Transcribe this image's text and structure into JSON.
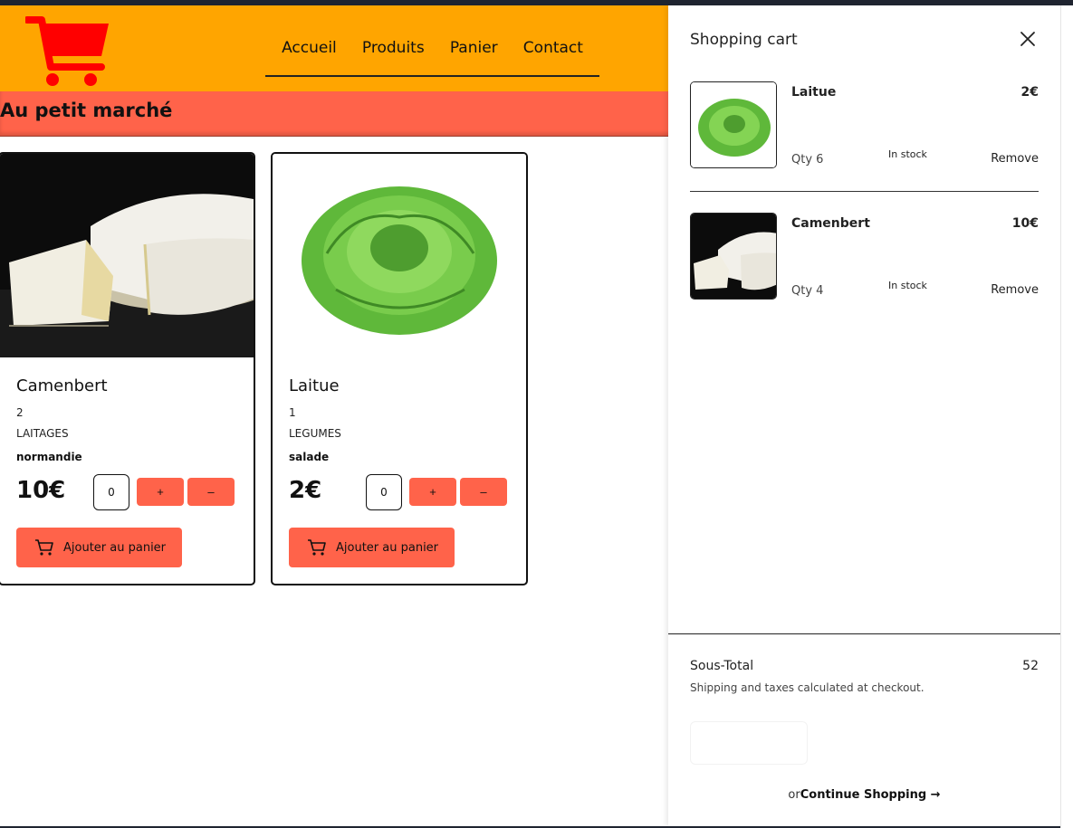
{
  "header": {
    "nav": [
      "Accueil",
      "Produits",
      "Panier",
      "Contact"
    ],
    "logo_icon": "shopping-cart-icon",
    "logo_color": "#ff0000",
    "bg_color": "#ffa500"
  },
  "page_title": "Au petit marché",
  "accent_color": "#ff634a",
  "products": [
    {
      "name": "Camenbert",
      "qty": "2",
      "category": "LAITAGES",
      "origin": "normandie",
      "price": "10€",
      "input_value": "0",
      "plus": "+",
      "minus": "–",
      "add_label": "Ajouter au panier"
    },
    {
      "name": "Laitue",
      "qty": "1",
      "category": "LEGUMES",
      "origin": "salade",
      "price": "2€",
      "input_value": "0",
      "plus": "+",
      "minus": "–",
      "add_label": "Ajouter au panier"
    }
  ],
  "cart": {
    "title": "Shopping cart",
    "items": [
      {
        "name": "Laitue",
        "price": "2€",
        "qty": "Qty 6",
        "stock": "In stock",
        "remove": "Remove"
      },
      {
        "name": "Camenbert",
        "price": "10€",
        "qty": "Qty 4",
        "stock": "In stock",
        "remove": "Remove"
      }
    ],
    "subtotal_label": "Sous-Total",
    "subtotal_value": "52",
    "shipping_note": "Shipping and taxes calculated at checkout.",
    "or_text": "or",
    "continue_label": "Continue Shopping →"
  }
}
